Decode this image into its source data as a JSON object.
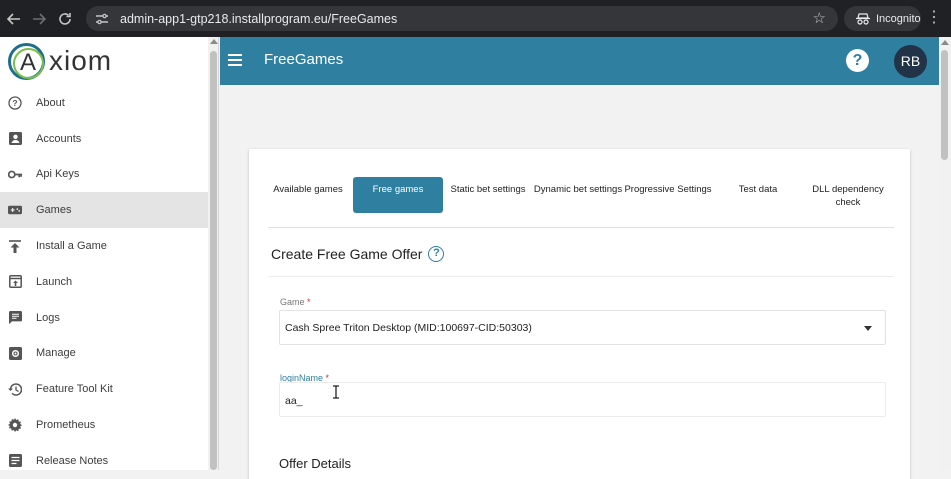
{
  "browser": {
    "url": "admin-app1-gtp218.installprogram.eu/FreeGames",
    "incognito_label": "Incognito"
  },
  "logo": {
    "text": "xiom",
    "glyph": "A"
  },
  "sidebar": {
    "items": [
      {
        "label": "About",
        "icon": "help-circle-icon"
      },
      {
        "label": "Accounts",
        "icon": "account-box-icon"
      },
      {
        "label": "Api Keys",
        "icon": "key-icon"
      },
      {
        "label": "Games",
        "icon": "gamepad-icon",
        "active": true
      },
      {
        "label": "Install a Game",
        "icon": "upload-icon"
      },
      {
        "label": "Launch",
        "icon": "launch-icon"
      },
      {
        "label": "Logs",
        "icon": "message-icon"
      },
      {
        "label": "Manage",
        "icon": "settings-box-icon"
      },
      {
        "label": "Feature Tool Kit",
        "icon": "history-icon"
      },
      {
        "label": "Prometheus",
        "icon": "gear-icon"
      },
      {
        "label": "Release Notes",
        "icon": "notes-icon"
      }
    ]
  },
  "appbar": {
    "title": "FreeGames",
    "help_glyph": "?",
    "avatar_initials": "RB",
    "color": "#2f7fa1"
  },
  "tabs": [
    {
      "label": "Available games"
    },
    {
      "label": "Free games",
      "active": true
    },
    {
      "label": "Static bet settings"
    },
    {
      "label": "Dynamic bet settings"
    },
    {
      "label": "Progressive Settings"
    },
    {
      "label": "Test data"
    },
    {
      "label": "DLL dependency check"
    }
  ],
  "form": {
    "title": "Create Free Game Offer",
    "info_glyph": "?",
    "game_label": "Game",
    "game_value": "Cash Spree Triton Desktop (MID:100697-CID:50303)",
    "login_label": "loginName",
    "login_value": "aa_",
    "required_mark": "*",
    "offer_details_title": "Offer Details"
  }
}
